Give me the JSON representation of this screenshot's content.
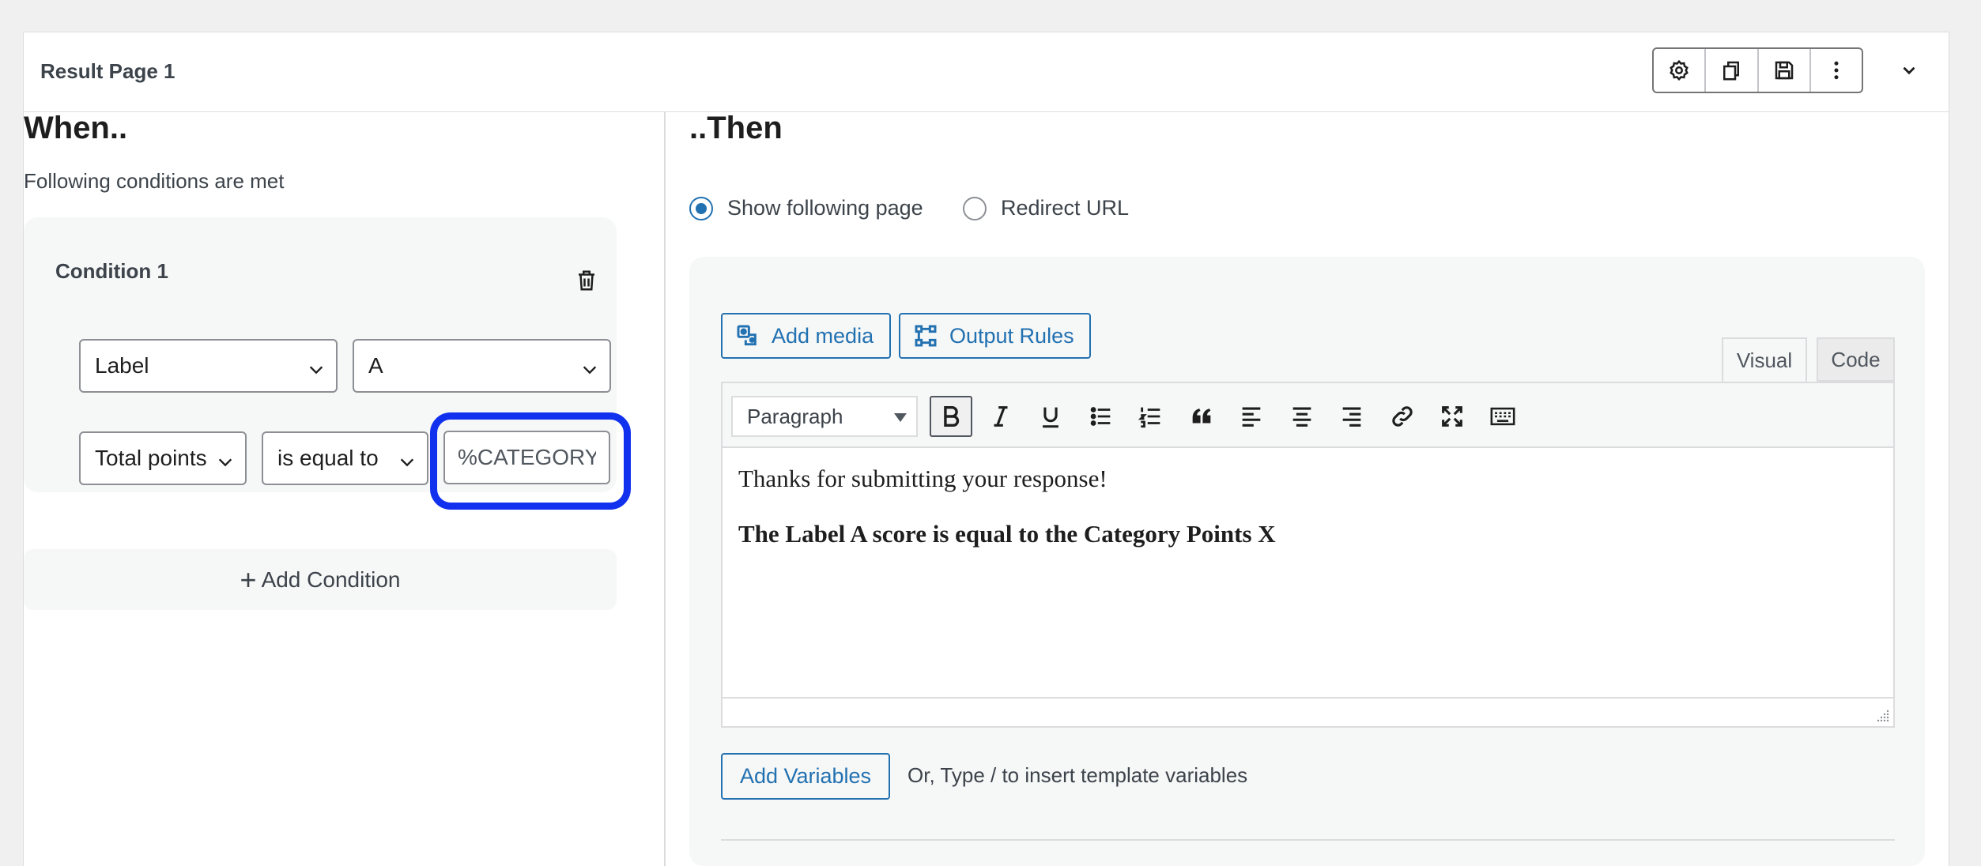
{
  "header": {
    "title": "Result Page 1",
    "toolbar": [
      "settings-icon",
      "duplicate-icon",
      "save-icon",
      "more-vertical-icon"
    ],
    "collapse_icon": "chevron-down-icon"
  },
  "when": {
    "title": "When..",
    "subtitle": "Following conditions are met",
    "condition": {
      "title": "Condition 1",
      "field1": "Label",
      "field2": "A",
      "field3": "Total points",
      "operator": "is equal to",
      "value": "%CATEGORY_"
    },
    "add_condition": "Add Condition",
    "add_condition_prefix": "+"
  },
  "then": {
    "title": "..Then",
    "options": [
      {
        "label": "Show following page",
        "selected": true
      },
      {
        "label": "Redirect URL",
        "selected": false
      }
    ],
    "add_media": "Add media",
    "output_rules": "Output Rules",
    "tabs": {
      "visual": "Visual",
      "code": "Code",
      "active": "Visual"
    },
    "editor": {
      "format": "Paragraph",
      "line1": "Thanks for submitting your response!",
      "line2": "The Label A score is equal to the Category Points X"
    },
    "add_variables": "Add Variables",
    "hint": "Or, Type / to insert template variables"
  },
  "colors": {
    "accent": "#2271b1",
    "focus": "#1131ee"
  }
}
